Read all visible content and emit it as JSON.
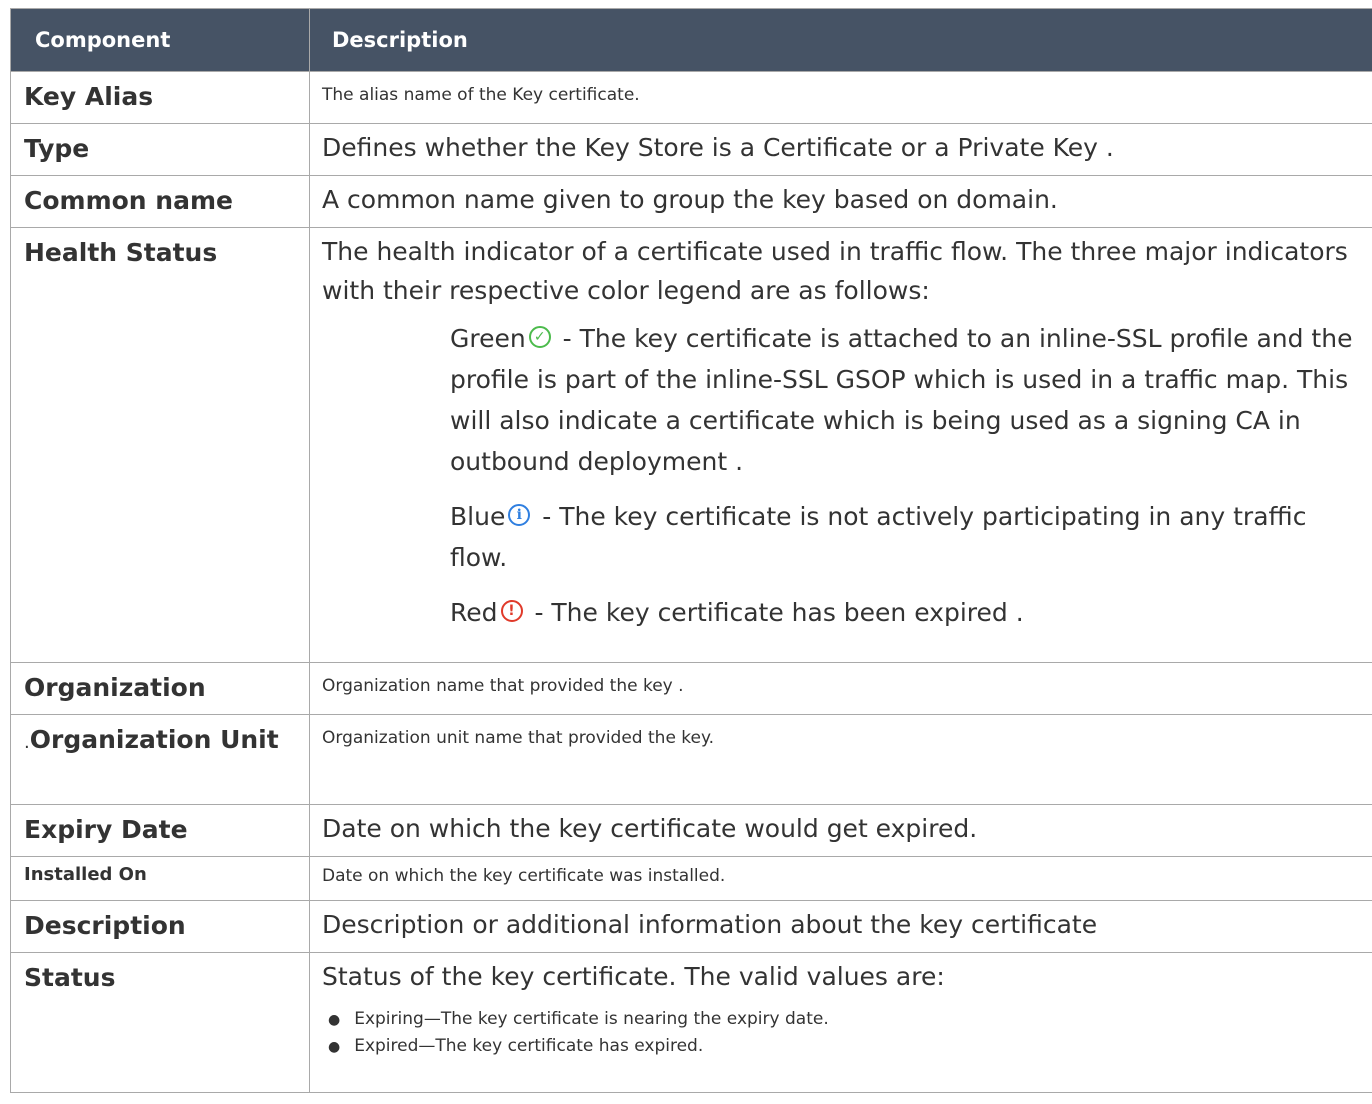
{
  "headers": {
    "component": "Component",
    "description": "Description"
  },
  "rows": [
    {
      "component": "Key Alias",
      "description": "The alias name of the Key certificate."
    },
    {
      "component": "Type",
      "description": "Defines whether the Key Store is a Certificate or a Private Key ."
    },
    {
      "component": "Common name",
      "description": "A common name given to group the key based on domain."
    },
    {
      "component": "Health Status",
      "description": "The health indicator of a certificate used in traffic flow. The three major indicators with their respective color legend are as follows:"
    },
    {
      "component": "Organization",
      "description": "Organization name that provided the key ."
    },
    {
      "prefix": ".",
      "component": "Organization Unit",
      "description": "Organization unit name that provided the key."
    },
    {
      "component": "Expiry Date",
      "description": "Date on which the key certificate would get expired."
    },
    {
      "component": "Installed On",
      "description": "Date on which the key certificate was installed."
    },
    {
      "component": "Description",
      "description": "Description or additional information about the key certificate"
    },
    {
      "component": "Status",
      "description": "Status of the key certificate. The valid values are:"
    }
  ],
  "health_indicators": [
    {
      "label": "Green",
      "icon": "check-circle-icon",
      "color": "#4cbb4c",
      "text": " - The key certificate is attached to an inline-SSL profile and the profile is part of the inline-SSL GSOP which is used in a traffic map. This will also indicate a certificate which is being used as a signing CA in outbound deployment ."
    },
    {
      "label": "Blue",
      "icon": "info-circle-icon",
      "color": "#2f7fe0",
      "text": " - The key certificate is not actively participating in any traffic flow."
    },
    {
      "label": "Red",
      "icon": "alert-circle-icon",
      "color": "#e03a2a",
      "text": " - The key certificate has been expired ."
    }
  ],
  "status_values": [
    "Expiring—The key certificate is nearing the expiry date.",
    "Expired—The key certificate has expired."
  ],
  "colors": {
    "header_bg": "#465365",
    "header_text": "#ffffff",
    "border": "#a9a9a9"
  }
}
